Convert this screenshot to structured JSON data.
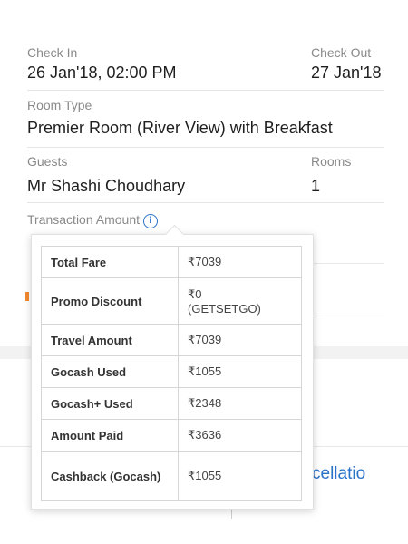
{
  "booking": {
    "check_in_label": "Check In",
    "check_in_value": "26 Jan'18, 02:00 PM",
    "check_out_label": "Check Out",
    "check_out_value": "27 Jan'18",
    "room_type_label": "Room Type",
    "room_type_value": "Premier Room (River View) with Breakfast",
    "guests_label": "Guests",
    "guests_value": "Mr Shashi Choudhary",
    "rooms_label": "Rooms",
    "rooms_value": "1",
    "transaction_label": "Transaction Amount",
    "info_icon_glyph": "i"
  },
  "fare_breakup": [
    {
      "label": "Total Fare",
      "value": "₹7039",
      "sub": ""
    },
    {
      "label": "Promo Discount",
      "value": "₹0",
      "sub": "(GETSETGO)"
    },
    {
      "label": "Travel Amount",
      "value": "₹7039",
      "sub": ""
    },
    {
      "label": "Gocash Used",
      "value": "₹1055",
      "sub": ""
    },
    {
      "label": "Gocash+ Used",
      "value": "₹2348",
      "sub": ""
    },
    {
      "label": "Amount Paid",
      "value": "₹3636",
      "sub": ""
    },
    {
      "label": "Cashback (Gocash)",
      "value": "₹1055",
      "sub": ""
    }
  ],
  "background": {
    "cancellation_fragment": "cellatio"
  },
  "colors": {
    "accent_blue": "#2a73c9",
    "label_gray": "#8a8a8a"
  }
}
